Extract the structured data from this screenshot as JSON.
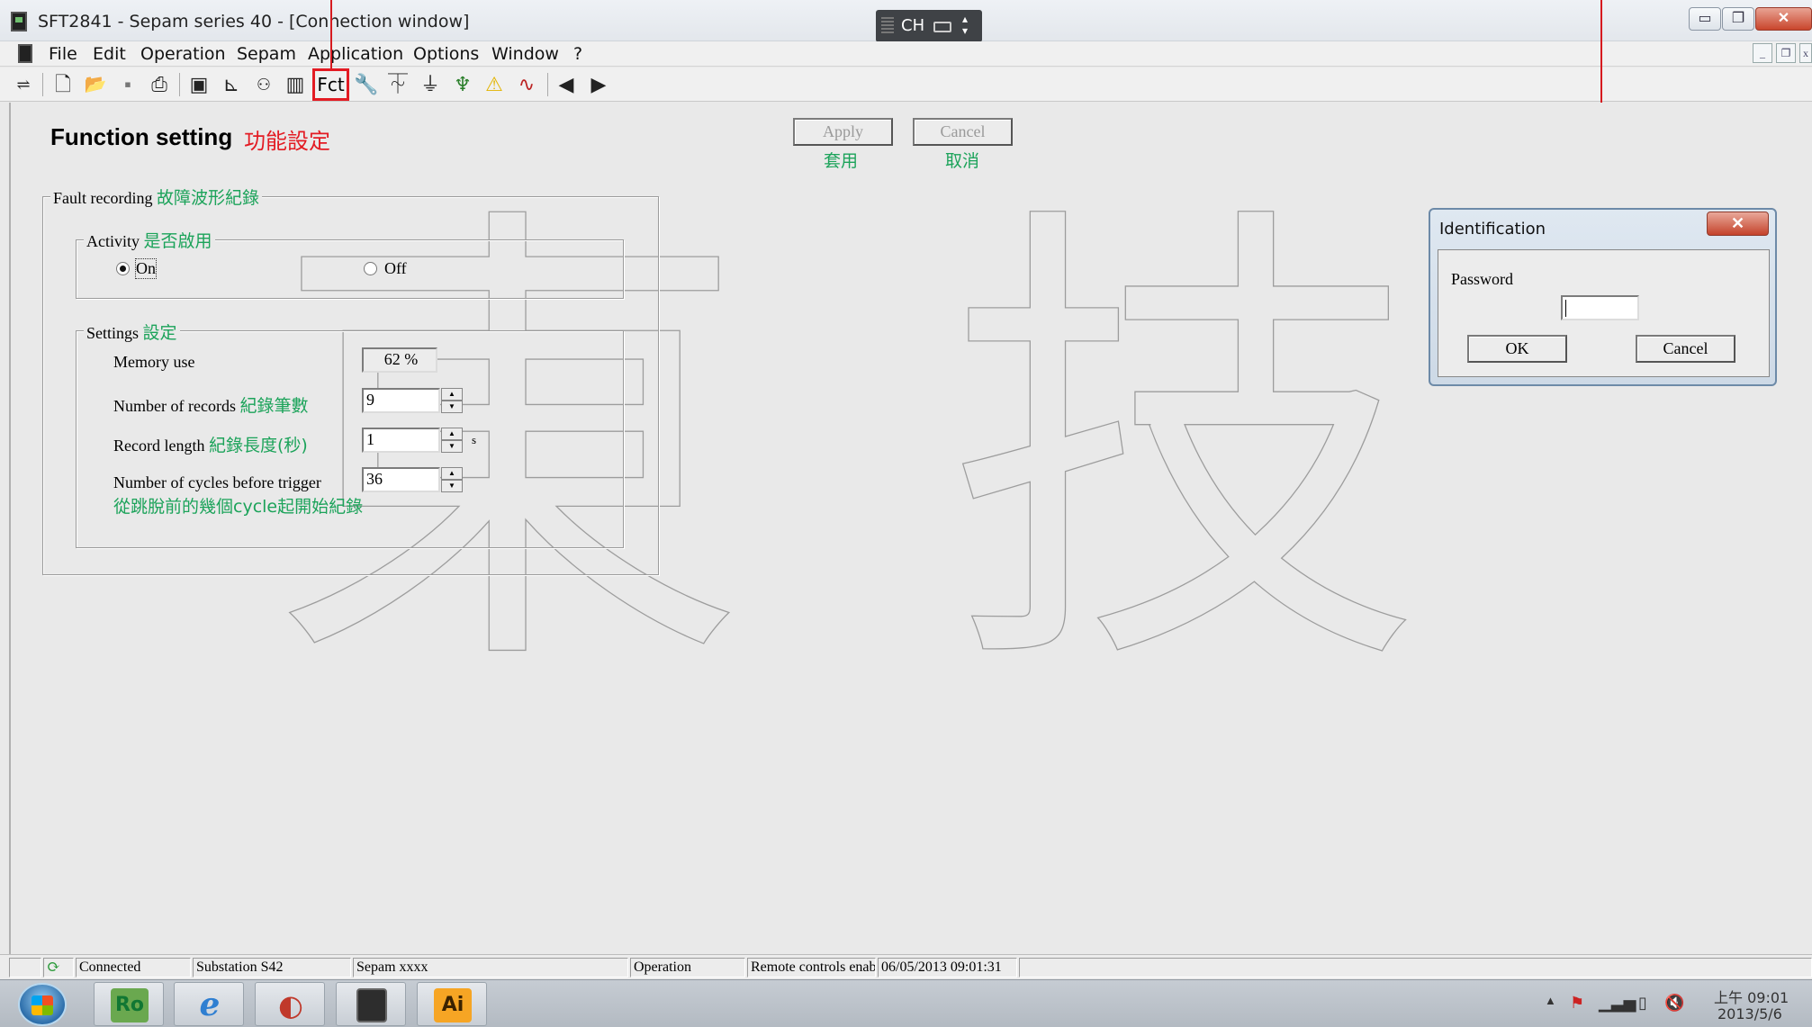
{
  "window": {
    "title": "SFT2841 - Sepam series 40 - [Connection window]",
    "ime_lang": "CH",
    "min_glyph": "▭",
    "max_glyph": "❐",
    "close_glyph": "✕"
  },
  "menu": {
    "items": [
      "File",
      "Edit",
      "Operation",
      "Sepam",
      "Application",
      "Options",
      "Window",
      "?"
    ]
  },
  "toolbar": {
    "fct_label": "Fct",
    "icons": [
      "connect-icon",
      "new-file-icon",
      "open-folder-icon",
      "save-icon",
      "print-icon",
      "sepam-unit-icon",
      "curve-icon",
      "network-icon",
      "table-icon",
      "wrench-icon",
      "hardware-icon",
      "tree-icon",
      "logic-icon",
      "warning-icon",
      "waveform-icon",
      "back-icon",
      "forward-icon"
    ]
  },
  "page": {
    "title": "Function setting",
    "title_cn": "功能設定",
    "apply_label": "Apply",
    "apply_cn": "套用",
    "cancel_label": "Cancel",
    "cancel_cn": "取消"
  },
  "fault_recording": {
    "legend": "Fault recording",
    "legend_cn": "故障波形紀錄",
    "activity": {
      "legend": "Activity",
      "legend_cn": "是否啟用",
      "on_label": "On",
      "off_label": "Off",
      "selected": "On"
    },
    "settings": {
      "legend": "Settings",
      "legend_cn": "設定",
      "memory_use_label": "Memory use",
      "memory_use_value": "62 %",
      "records_label": "Number of records",
      "records_cn": "紀錄筆數",
      "records_value": "9",
      "length_label": "Record length",
      "length_cn": "紀錄長度(秒)",
      "length_value": "1",
      "length_unit": "s",
      "cycles_label": "Number of cycles before trigger",
      "cycles_value": "36",
      "cycles_cn": "從跳脫前的幾個cycle起開始紀錄"
    }
  },
  "dialog": {
    "title": "Identification",
    "password_label": "Password",
    "password_value": "",
    "ok_label": "OK",
    "cancel_label": "Cancel",
    "close_glyph": "✕"
  },
  "status": {
    "connection": "Connected",
    "substation": "Substation S42",
    "sepam": "Sepam xxxx",
    "mode": "Operation",
    "remote": "Remote controls enab",
    "datetime": "06/05/2013  09:01:31"
  },
  "taskbar": {
    "apps": [
      {
        "name": "Ro",
        "color": "#6aa84f"
      },
      {
        "name": "",
        "color": "#2f7fd1"
      },
      {
        "name": "",
        "color": "#c0392b"
      },
      {
        "name": "",
        "color": "#2d2d2d"
      },
      {
        "name": "Ai",
        "color": "#f6a524"
      }
    ],
    "clock_time": "上午 09:01",
    "clock_date": "2013/5/6"
  },
  "watermark": {
    "text": "東技"
  }
}
